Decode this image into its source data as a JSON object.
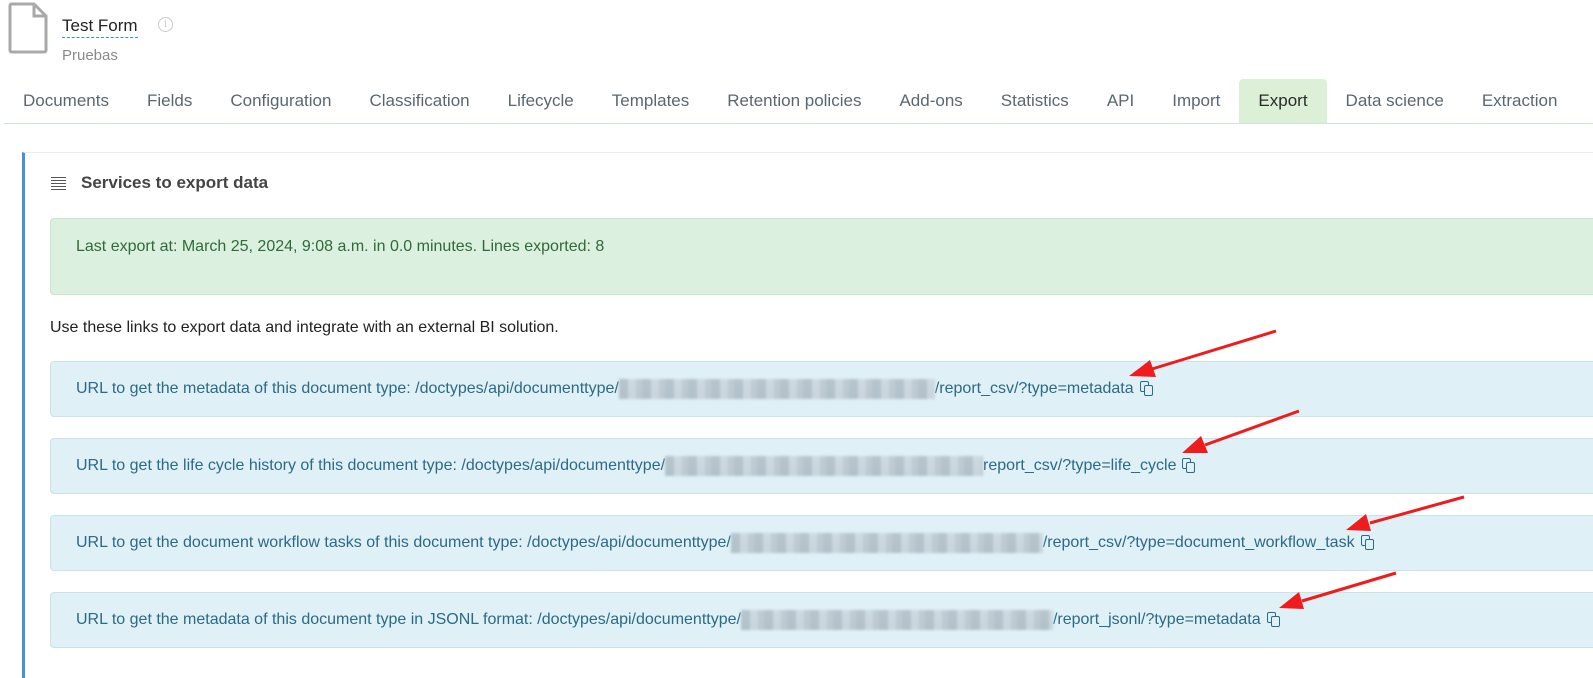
{
  "header": {
    "title": "Test Form",
    "info_icon": "info-icon",
    "subtitle": "Pruebas"
  },
  "tabs": [
    {
      "label": "Documents",
      "active": false
    },
    {
      "label": "Fields",
      "active": false
    },
    {
      "label": "Configuration",
      "active": false
    },
    {
      "label": "Classification",
      "active": false
    },
    {
      "label": "Lifecycle",
      "active": false
    },
    {
      "label": "Templates",
      "active": false
    },
    {
      "label": "Retention policies",
      "active": false
    },
    {
      "label": "Add-ons",
      "active": false
    },
    {
      "label": "Statistics",
      "active": false
    },
    {
      "label": "API",
      "active": false
    },
    {
      "label": "Import",
      "active": false
    },
    {
      "label": "Export",
      "active": true
    },
    {
      "label": "Data science",
      "active": false
    },
    {
      "label": "Extraction",
      "active": false
    }
  ],
  "panel": {
    "title": "Services to export data",
    "last_export": "Last export at: March 25, 2024, 9:08 a.m. in 0.0 minutes. Lines exported: 8",
    "intro": "Use these links to export data and integrate with an external BI solution.",
    "urls": [
      {
        "label": "URL to get the metadata of this document type: /doctypes/api/documenttype/",
        "suffix": "/report_csv/?type=metadata"
      },
      {
        "label": "URL to get the life cycle history of this document type: /doctypes/api/documenttype/",
        "suffix": "report_csv/?type=life_cycle"
      },
      {
        "label": "URL to get the document workflow tasks of this document type: /doctypes/api/documenttype/",
        "suffix": "/report_csv/?type=document_workflow_task"
      },
      {
        "label": "URL to get the metadata of this document type in JSONL format: /doctypes/api/documenttype/",
        "suffix": "/report_jsonl/?type=metadata"
      }
    ]
  },
  "colors": {
    "active_tab_bg": "#dbf0d7",
    "success_bg": "#dbf0df",
    "info_bg": "#dff0f7",
    "info_text": "#2c6a85",
    "panel_accent": "#4a90d9",
    "annotation_arrow": "#ee1c1c"
  }
}
